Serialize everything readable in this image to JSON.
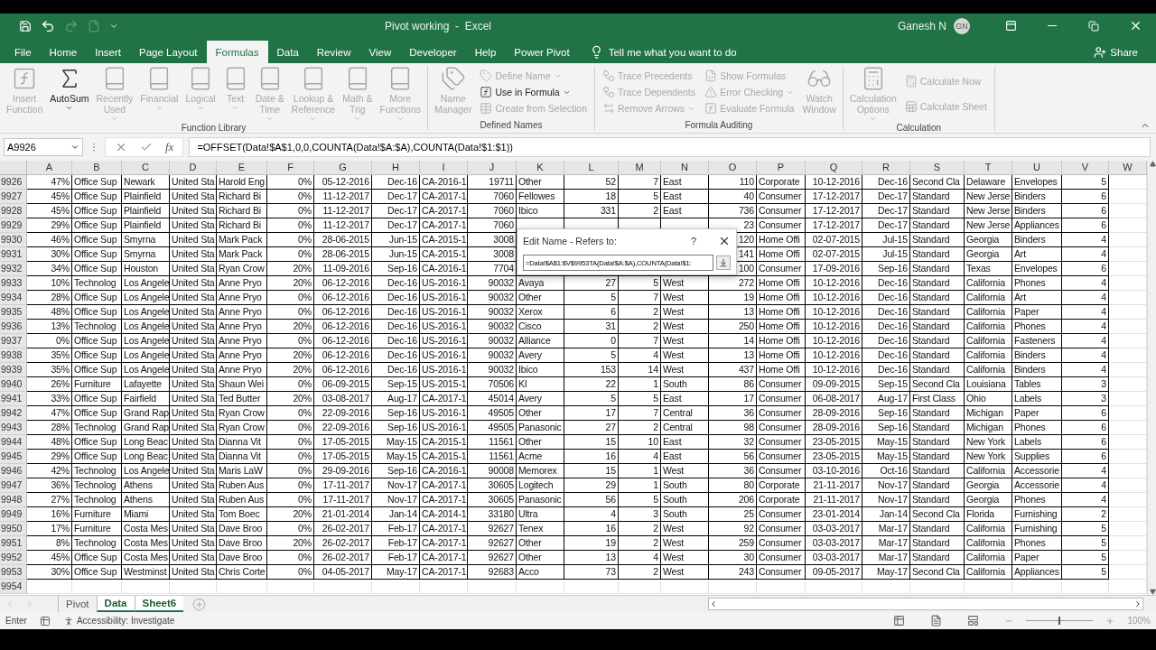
{
  "title_bar": {
    "title": "Pivot working  -  Excel",
    "user": "Ganesh N",
    "avatar": "GN"
  },
  "tabs": [
    {
      "label": "File",
      "selected": false
    },
    {
      "label": "Home",
      "selected": false
    },
    {
      "label": "Insert",
      "selected": false
    },
    {
      "label": "Page Layout",
      "selected": false
    },
    {
      "label": "Formulas",
      "selected": true
    },
    {
      "label": "Data",
      "selected": false
    },
    {
      "label": "Review",
      "selected": false
    },
    {
      "label": "View",
      "selected": false
    },
    {
      "label": "Developer",
      "selected": false
    },
    {
      "label": "Help",
      "selected": false
    },
    {
      "label": "Power Pivot",
      "selected": false
    }
  ],
  "tell_me": "Tell me what you want to do",
  "share": "Share",
  "ribbon": [
    {
      "label": "Function Library",
      "commands": [
        {
          "kind": "large",
          "label": "Insert\nFunction",
          "disabled": true,
          "dropdown": false
        },
        {
          "kind": "large",
          "label": "AutoSum",
          "disabled": false,
          "dropdown": true
        },
        {
          "kind": "large",
          "label": "Recently\nUsed",
          "disabled": true,
          "dropdown": true
        },
        {
          "kind": "large",
          "label": "Financial",
          "disabled": true,
          "dropdown": true
        },
        {
          "kind": "large",
          "label": "Logical",
          "disabled": true,
          "dropdown": true
        },
        {
          "kind": "large",
          "label": "Text",
          "disabled": true,
          "dropdown": true
        },
        {
          "kind": "large",
          "label": "Date &\nTime",
          "disabled": true,
          "dropdown": true
        },
        {
          "kind": "large",
          "label": "Lookup &\nReference",
          "disabled": true,
          "dropdown": true
        },
        {
          "kind": "large",
          "label": "Math &\nTrig",
          "disabled": true,
          "dropdown": true
        },
        {
          "kind": "large",
          "label": "More\nFunctions",
          "disabled": true,
          "dropdown": true
        }
      ]
    },
    {
      "label": "Defined Names",
      "commands": [
        {
          "kind": "large",
          "label": "Name\nManager",
          "disabled": true,
          "dropdown": false
        },
        {
          "kind": "small",
          "label": "Define Name",
          "disabled": true,
          "dropdown": true
        },
        {
          "kind": "small",
          "label": "Use in Formula",
          "disabled": false,
          "dropdown": true
        },
        {
          "kind": "small",
          "label": "Create from Selection",
          "disabled": true,
          "dropdown": false
        }
      ]
    },
    {
      "label": "Formula Auditing",
      "commands": [
        {
          "kind": "small",
          "label": "Trace Precedents",
          "disabled": true,
          "dropdown": false
        },
        {
          "kind": "small",
          "label": "Trace Dependents",
          "disabled": true,
          "dropdown": false
        },
        {
          "kind": "small",
          "label": "Remove Arrows",
          "disabled": true,
          "dropdown": true
        },
        {
          "kind": "small",
          "label": "Show Formulas",
          "disabled": true,
          "dropdown": false
        },
        {
          "kind": "small",
          "label": "Error Checking",
          "disabled": true,
          "dropdown": true
        },
        {
          "kind": "small",
          "label": "Evaluate Formula",
          "disabled": true,
          "dropdown": false
        },
        {
          "kind": "large",
          "label": "Watch\nWindow",
          "disabled": true,
          "dropdown": false
        }
      ]
    },
    {
      "label": "Calculation",
      "commands": [
        {
          "kind": "large",
          "label": "Calculation\nOptions",
          "disabled": true,
          "dropdown": true
        },
        {
          "kind": "small",
          "label": "Calculate Now",
          "disabled": true,
          "dropdown": false
        },
        {
          "kind": "small",
          "label": "Calculate Sheet",
          "disabled": true,
          "dropdown": false
        }
      ]
    }
  ],
  "formula_bar": {
    "name_box": "A9926",
    "function_label": "fx",
    "formula": "=OFFSET(Data!$A$1,0,0,COUNTA(Data!$A:$A),COUNTA(Data!$1:$1))"
  },
  "columns": [
    {
      "letter": "A",
      "kind": "number"
    },
    {
      "letter": "B",
      "kind": "text"
    },
    {
      "letter": "C",
      "kind": "text"
    },
    {
      "letter": "D",
      "kind": "text"
    },
    {
      "letter": "E",
      "kind": "text"
    },
    {
      "letter": "F",
      "kind": "number"
    },
    {
      "letter": "G",
      "kind": "number"
    },
    {
      "letter": "H",
      "kind": "number"
    },
    {
      "letter": "I",
      "kind": "text"
    },
    {
      "letter": "J",
      "kind": "number"
    },
    {
      "letter": "K",
      "kind": "text"
    },
    {
      "letter": "L",
      "kind": "number"
    },
    {
      "letter": "M",
      "kind": "number"
    },
    {
      "letter": "N",
      "kind": "text"
    },
    {
      "letter": "O",
      "kind": "number"
    },
    {
      "letter": "P",
      "kind": "text"
    },
    {
      "letter": "Q",
      "kind": "number"
    },
    {
      "letter": "R",
      "kind": "number"
    },
    {
      "letter": "S",
      "kind": "text"
    },
    {
      "letter": "T",
      "kind": "text"
    },
    {
      "letter": "U",
      "kind": "text"
    },
    {
      "letter": "V",
      "kind": "number"
    },
    {
      "letter": "W",
      "kind": "text"
    }
  ],
  "rows": [
    {
      "number": "9926",
      "bordered": true,
      "cells": [
        "47%",
        "Office Sup",
        "Newark",
        "United Sta",
        "Harold Eng",
        "0%",
        "05-12-2016",
        "Dec-16",
        "CA-2016-1",
        "19711",
        "Other",
        "52",
        "7",
        "East",
        "110",
        "Corporate",
        "10-12-2016",
        "Dec-16",
        "Second Cla",
        "Delaware",
        "Envelopes",
        "5"
      ]
    },
    {
      "number": "9927",
      "bordered": true,
      "cells": [
        "45%",
        "Office Sup",
        "Plainfield",
        "United Sta",
        "Richard Bi",
        "0%",
        "11-12-2017",
        "Dec-17",
        "CA-2017-1",
        "7060",
        "Fellowes",
        "18",
        "5",
        "East",
        "40",
        "Consumer",
        "17-12-2017",
        "Dec-17",
        "Standard",
        "New Jerse",
        "Binders",
        "6"
      ]
    },
    {
      "number": "9928",
      "bordered": true,
      "cells": [
        "45%",
        "Office Sup",
        "Plainfield",
        "United Sta",
        "Richard Bi",
        "0%",
        "11-12-2017",
        "Dec-17",
        "CA-2017-1",
        "7060",
        "Ibico",
        "331",
        "2",
        "East",
        "736",
        "Consumer",
        "17-12-2017",
        "Dec-17",
        "Standard",
        "New Jerse",
        "Binders",
        "6"
      ]
    },
    {
      "number": "9929",
      "bordered": true,
      "cells": [
        "29%",
        "Office Sup",
        "Plainfield",
        "United Sta",
        "Richard Bi",
        "0%",
        "11-12-2017",
        "Dec-17",
        "CA-2017-1",
        "7060",
        null,
        null,
        null,
        null,
        "23",
        "Consumer",
        "17-12-2017",
        "Dec-17",
        "Standard",
        "New Jerse",
        "Appliances",
        "6"
      ]
    },
    {
      "number": "9930",
      "bordered": true,
      "cells": [
        "46%",
        "Office Sup",
        "Smyrna",
        "United Sta",
        "Mark Pack",
        "0%",
        "28-06-2015",
        "Jun-15",
        "CA-2015-1",
        "3008",
        null,
        null,
        null,
        null,
        "120",
        "Home Offi",
        "02-07-2015",
        "Jul-15",
        "Standard",
        "Georgia",
        "Binders",
        "4"
      ]
    },
    {
      "number": "9931",
      "bordered": true,
      "cells": [
        "30%",
        "Office Sup",
        "Smyrna",
        "United Sta",
        "Mark Pack",
        "0%",
        "28-06-2015",
        "Jun-15",
        "CA-2015-1",
        "3008",
        null,
        null,
        null,
        null,
        "141",
        "Home Offi",
        "02-07-2015",
        "Jul-15",
        "Standard",
        "Georgia",
        "Art",
        "4"
      ]
    },
    {
      "number": "9932",
      "bordered": true,
      "cells": [
        "34%",
        "Office Sup",
        "Houston",
        "United Sta",
        "Ryan Crow",
        "20%",
        "11-09-2016",
        "Sep-16",
        "CA-2016-1",
        "7704",
        null,
        null,
        null,
        null,
        "100",
        "Consumer",
        "17-09-2016",
        "Sep-16",
        "Standard",
        "Texas",
        "Envelopes",
        "6"
      ]
    },
    {
      "number": "9933",
      "bordered": true,
      "cells": [
        "10%",
        "Technolog",
        "Los Angele",
        "United Sta",
        "Anne Pryo",
        "20%",
        "06-12-2016",
        "Dec-16",
        "US-2016-1",
        "90032",
        "Avaya",
        "27",
        "5",
        "West",
        "272",
        "Home Offi",
        "10-12-2016",
        "Dec-16",
        "Standard",
        "California",
        "Phones",
        "4"
      ]
    },
    {
      "number": "9934",
      "bordered": true,
      "cells": [
        "28%",
        "Office Sup",
        "Los Angele",
        "United Sta",
        "Anne Pryo",
        "0%",
        "06-12-2016",
        "Dec-16",
        "US-2016-1",
        "90032",
        "Other",
        "5",
        "7",
        "West",
        "19",
        "Home Offi",
        "10-12-2016",
        "Dec-16",
        "Standard",
        "California",
        "Art",
        "4"
      ]
    },
    {
      "number": "9935",
      "bordered": true,
      "cells": [
        "48%",
        "Office Sup",
        "Los Angele",
        "United Sta",
        "Anne Pryo",
        "0%",
        "06-12-2016",
        "Dec-16",
        "US-2016-1",
        "90032",
        "Xerox",
        "6",
        "2",
        "West",
        "13",
        "Home Offi",
        "10-12-2016",
        "Dec-16",
        "Standard",
        "California",
        "Paper",
        "4"
      ]
    },
    {
      "number": "9936",
      "bordered": true,
      "cells": [
        "13%",
        "Technolog",
        "Los Angele",
        "United Sta",
        "Anne Pryo",
        "20%",
        "06-12-2016",
        "Dec-16",
        "US-2016-1",
        "90032",
        "Cisco",
        "31",
        "2",
        "West",
        "250",
        "Home Offi",
        "10-12-2016",
        "Dec-16",
        "Standard",
        "California",
        "Phones",
        "4"
      ]
    },
    {
      "number": "9937",
      "bordered": true,
      "cells": [
        "0%",
        "Office Sup",
        "Los Angele",
        "United Sta",
        "Anne Pryo",
        "0%",
        "06-12-2016",
        "Dec-16",
        "US-2016-1",
        "90032",
        "Alliance",
        "0",
        "7",
        "West",
        "14",
        "Home Offi",
        "10-12-2016",
        "Dec-16",
        "Standard",
        "California",
        "Fasteners",
        "4"
      ]
    },
    {
      "number": "9938",
      "bordered": true,
      "cells": [
        "35%",
        "Office Sup",
        "Los Angele",
        "United Sta",
        "Anne Pryo",
        "20%",
        "06-12-2016",
        "Dec-16",
        "US-2016-1",
        "90032",
        "Avery",
        "5",
        "4",
        "West",
        "13",
        "Home Offi",
        "10-12-2016",
        "Dec-16",
        "Standard",
        "California",
        "Binders",
        "4"
      ]
    },
    {
      "number": "9939",
      "bordered": true,
      "cells": [
        "35%",
        "Office Sup",
        "Los Angele",
        "United Sta",
        "Anne Pryo",
        "20%",
        "06-12-2016",
        "Dec-16",
        "US-2016-1",
        "90032",
        "Ibico",
        "153",
        "14",
        "West",
        "437",
        "Home Offi",
        "10-12-2016",
        "Dec-16",
        "Standard",
        "California",
        "Binders",
        "4"
      ]
    },
    {
      "number": "9940",
      "bordered": true,
      "cells": [
        "26%",
        "Furniture",
        "Lafayette",
        "United Sta",
        "Shaun Wei",
        "0%",
        "06-09-2015",
        "Sep-15",
        "US-2015-1",
        "70506",
        "KI",
        "22",
        "1",
        "South",
        "86",
        "Consumer",
        "09-09-2015",
        "Sep-15",
        "Second Cla",
        "Louisiana",
        "Tables",
        "3"
      ]
    },
    {
      "number": "9941",
      "bordered": true,
      "cells": [
        "33%",
        "Office Sup",
        "Fairfield",
        "United Sta",
        "Ted Butter",
        "20%",
        "03-08-2017",
        "Aug-17",
        "CA-2017-1",
        "45014",
        "Avery",
        "5",
        "5",
        "East",
        "17",
        "Consumer",
        "06-08-2017",
        "Aug-17",
        "First Class",
        "Ohio",
        "Labels",
        "3"
      ]
    },
    {
      "number": "9942",
      "bordered": true,
      "cells": [
        "47%",
        "Office Sup",
        "Grand Rap",
        "United Sta",
        "Ryan Crow",
        "0%",
        "22-09-2016",
        "Sep-16",
        "US-2016-1",
        "49505",
        "Other",
        "17",
        "7",
        "Central",
        "36",
        "Consumer",
        "28-09-2016",
        "Sep-16",
        "Standard",
        "Michigan",
        "Paper",
        "6"
      ]
    },
    {
      "number": "9943",
      "bordered": true,
      "cells": [
        "28%",
        "Technolog",
        "Grand Rap",
        "United Sta",
        "Ryan Crow",
        "0%",
        "22-09-2016",
        "Sep-16",
        "US-2016-1",
        "49505",
        "Panasonic",
        "27",
        "2",
        "Central",
        "98",
        "Consumer",
        "28-09-2016",
        "Sep-16",
        "Standard",
        "Michigan",
        "Phones",
        "6"
      ]
    },
    {
      "number": "9944",
      "bordered": true,
      "cells": [
        "48%",
        "Office Sup",
        "Long Beac",
        "United Sta",
        "Dianna Vit",
        "0%",
        "17-05-2015",
        "May-15",
        "CA-2015-1",
        "11561",
        "Other",
        "15",
        "10",
        "East",
        "32",
        "Consumer",
        "23-05-2015",
        "May-15",
        "Standard",
        "New York",
        "Labels",
        "6"
      ]
    },
    {
      "number": "9945",
      "bordered": true,
      "cells": [
        "29%",
        "Office Sup",
        "Long Beac",
        "United Sta",
        "Dianna Vit",
        "0%",
        "17-05-2015",
        "May-15",
        "CA-2015-1",
        "11561",
        "Acme",
        "16",
        "4",
        "East",
        "56",
        "Consumer",
        "23-05-2015",
        "May-15",
        "Standard",
        "New York",
        "Supplies",
        "6"
      ]
    },
    {
      "number": "9946",
      "bordered": true,
      "cells": [
        "42%",
        "Technolog",
        "Los Angele",
        "United Sta",
        "Maris LaW",
        "0%",
        "29-09-2016",
        "Sep-16",
        "CA-2016-1",
        "90008",
        "Memorex",
        "15",
        "1",
        "West",
        "36",
        "Consumer",
        "03-10-2016",
        "Oct-16",
        "Standard",
        "California",
        "Accessorie",
        "4"
      ]
    },
    {
      "number": "9947",
      "bordered": true,
      "cells": [
        "36%",
        "Technolog",
        "Athens",
        "United Sta",
        "Ruben Aus",
        "0%",
        "17-11-2017",
        "Nov-17",
        "CA-2017-1",
        "30605",
        "Logitech",
        "29",
        "1",
        "South",
        "80",
        "Corporate",
        "21-11-2017",
        "Nov-17",
        "Standard",
        "Georgia",
        "Accessorie",
        "4"
      ]
    },
    {
      "number": "9948",
      "bordered": true,
      "cells": [
        "27%",
        "Technolog",
        "Athens",
        "United Sta",
        "Ruben Aus",
        "0%",
        "17-11-2017",
        "Nov-17",
        "CA-2017-1",
        "30605",
        "Panasonic",
        "56",
        "5",
        "South",
        "206",
        "Corporate",
        "21-11-2017",
        "Nov-17",
        "Standard",
        "Georgia",
        "Phones",
        "4"
      ]
    },
    {
      "number": "9949",
      "bordered": true,
      "cells": [
        "16%",
        "Furniture",
        "Miami",
        "United Sta",
        "Tom Boec",
        "20%",
        "21-01-2014",
        "Jan-14",
        "CA-2014-1",
        "33180",
        "Ultra",
        "4",
        "3",
        "South",
        "25",
        "Consumer",
        "23-01-2014",
        "Jan-14",
        "Second Cla",
        "Florida",
        "Furnishing",
        "2"
      ]
    },
    {
      "number": "9950",
      "bordered": true,
      "cells": [
        "17%",
        "Furniture",
        "Costa Mes",
        "United Sta",
        "Dave Broo",
        "0%",
        "26-02-2017",
        "Feb-17",
        "CA-2017-1",
        "92627",
        "Tenex",
        "16",
        "2",
        "West",
        "92",
        "Consumer",
        "03-03-2017",
        "Mar-17",
        "Standard",
        "California",
        "Furnishing",
        "5"
      ]
    },
    {
      "number": "9951",
      "bordered": true,
      "cells": [
        "8%",
        "Technolog",
        "Costa Mes",
        "United Sta",
        "Dave Broo",
        "20%",
        "26-02-2017",
        "Feb-17",
        "CA-2017-1",
        "92627",
        "Other",
        "19",
        "2",
        "West",
        "259",
        "Consumer",
        "03-03-2017",
        "Mar-17",
        "Standard",
        "California",
        "Phones",
        "5"
      ]
    },
    {
      "number": "9952",
      "bordered": true,
      "cells": [
        "45%",
        "Office Sup",
        "Costa Mes",
        "United Sta",
        "Dave Broo",
        "0%",
        "26-02-2017",
        "Feb-17",
        "CA-2017-1",
        "92627",
        "Other",
        "13",
        "4",
        "West",
        "30",
        "Consumer",
        "03-03-2017",
        "Mar-17",
        "Standard",
        "California",
        "Paper",
        "5"
      ]
    },
    {
      "number": "9953",
      "bordered": true,
      "cells": [
        "30%",
        "Office Sup",
        "Westminst",
        "United Sta",
        "Chris Corte",
        "0%",
        "04-05-2017",
        "May-17",
        "CA-2017-1",
        "92683",
        "Acco",
        "73",
        "2",
        "West",
        "243",
        "Consumer",
        "09-05-2017",
        "May-17",
        "Second Cla",
        "California",
        "Appliances",
        "5"
      ]
    },
    {
      "number": "9954",
      "bordered": false,
      "cells": []
    }
  ],
  "dialog": {
    "title": "Edit Name - Refers to:",
    "help": "?",
    "value": "=Data!$A$1:$V$9953TA(Data!$A:$A),COUNTA(Data!$1:"
  },
  "sheet_tabs": [
    {
      "label": "Pivot",
      "selected": false
    },
    {
      "label": "Data",
      "selected": true
    },
    {
      "label": "Sheet6",
      "selected": true
    }
  ],
  "status_bar": {
    "mode": "Enter",
    "accessibility": "Accessibility: Investigate",
    "zoom": {
      "level": 0.5,
      "reading": "100%"
    }
  }
}
